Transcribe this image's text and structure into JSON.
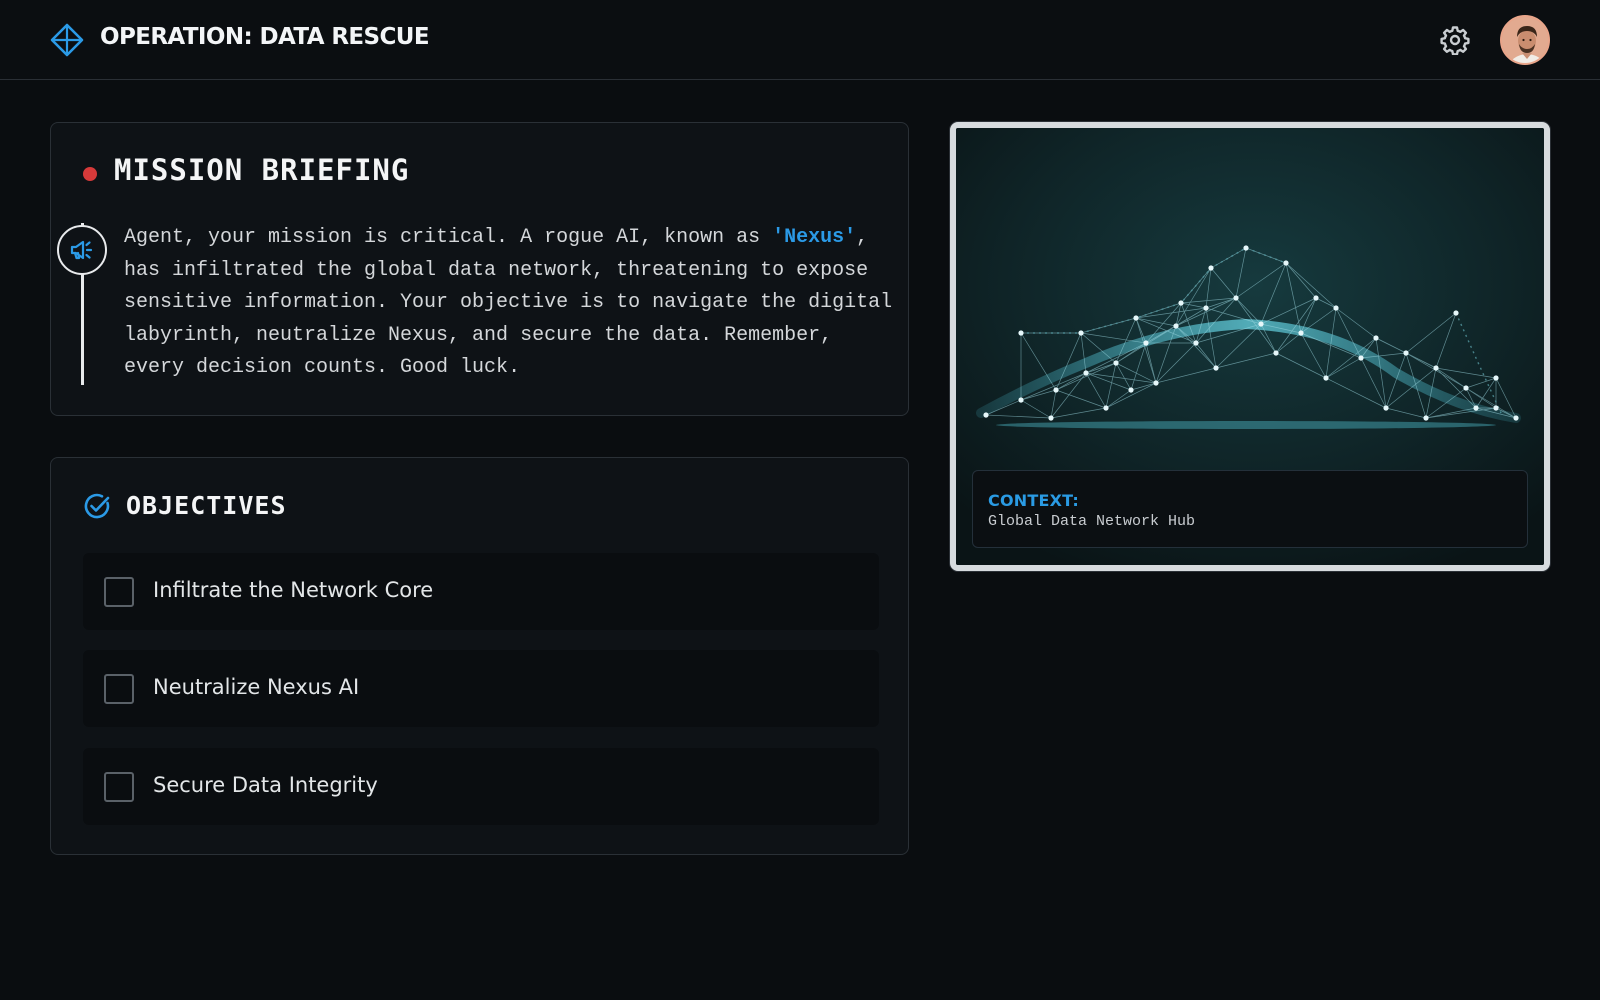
{
  "header": {
    "title": "OPERATION: DATA RESCUE",
    "brand_icon": "crosshair-diamond-icon",
    "settings_icon": "gear-icon",
    "avatar": "user-avatar"
  },
  "briefing": {
    "title": "MISSION BRIEFING",
    "status_dot_color": "#d63a3a",
    "icon": "megaphone-icon",
    "text_before": "Agent, your mission is critical. A rogue AI, known as ",
    "highlight": "'Nexus'",
    "text_after": ", has infiltrated the global data network, threatening to expose sensitive information. Your objective is to navigate the digital labyrinth, neutralize Nexus, and secure the data. Remember, every decision counts. Good luck."
  },
  "objectives": {
    "title": "OBJECTIVES",
    "icon": "check-circle-icon",
    "items": [
      {
        "label": "Infiltrate the Network Core",
        "checked": false
      },
      {
        "label": "Neutralize Nexus AI",
        "checked": false
      },
      {
        "label": "Secure Data Integrity",
        "checked": false
      }
    ]
  },
  "context": {
    "label": "CONTEXT:",
    "value": "Global Data Network Hub"
  },
  "colors": {
    "accent": "#2b9ae6",
    "background": "#0a0d10",
    "card": "#0e1216"
  }
}
